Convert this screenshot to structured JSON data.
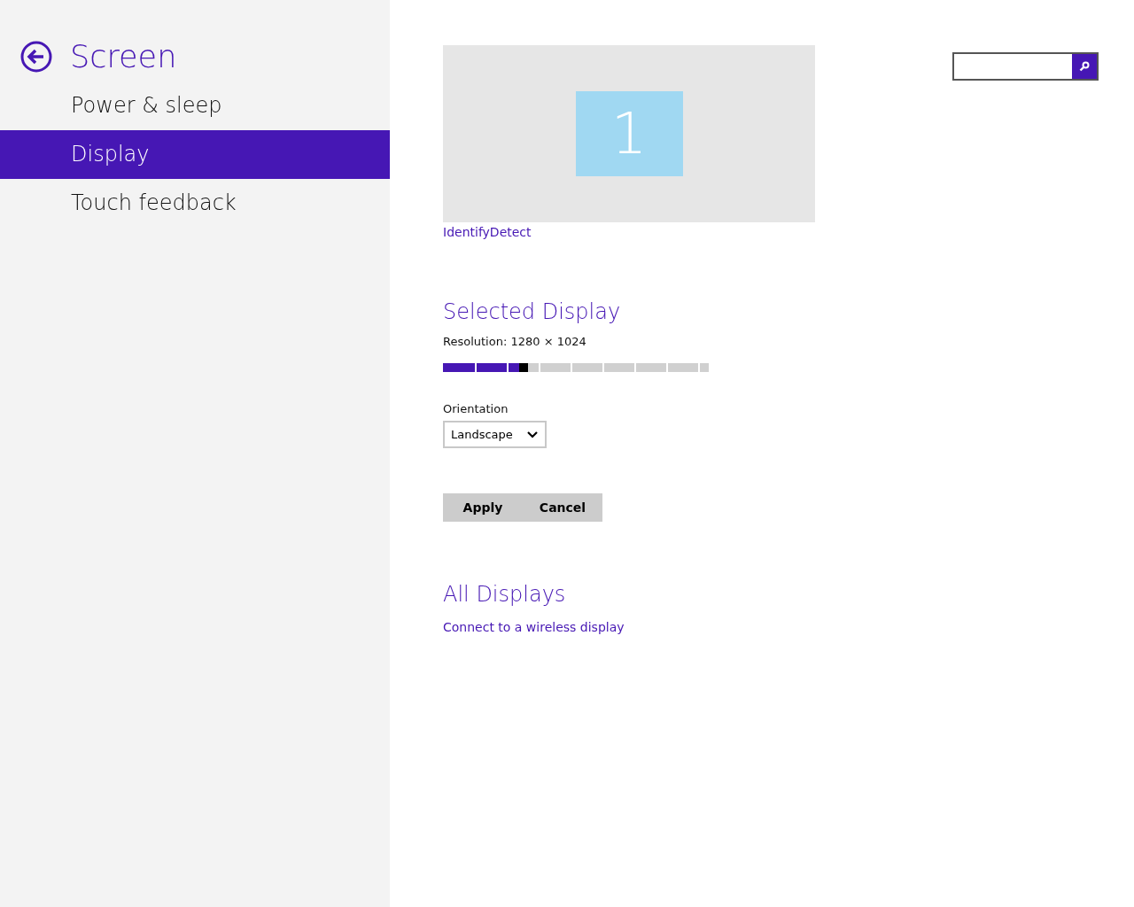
{
  "sidebar": {
    "title": "Screen",
    "items": [
      {
        "label": "Power & sleep",
        "selected": false
      },
      {
        "label": "Display",
        "selected": true
      },
      {
        "label": "Touch feedback",
        "selected": false
      }
    ]
  },
  "monitor": {
    "number": "1"
  },
  "identify_link": "IdentifyDetect",
  "selected_display": {
    "heading": "Selected Display",
    "resolution_label": "Resolution: 1280 × 1024",
    "resolution_slider": {
      "level": 0.32
    },
    "orientation_label": "Orientation",
    "orientation_value": "Landscape"
  },
  "buttons": [
    "Apply",
    "Cancel"
  ],
  "all_displays": {
    "heading": "All Displays",
    "link": "Connect to a wireless display"
  }
}
